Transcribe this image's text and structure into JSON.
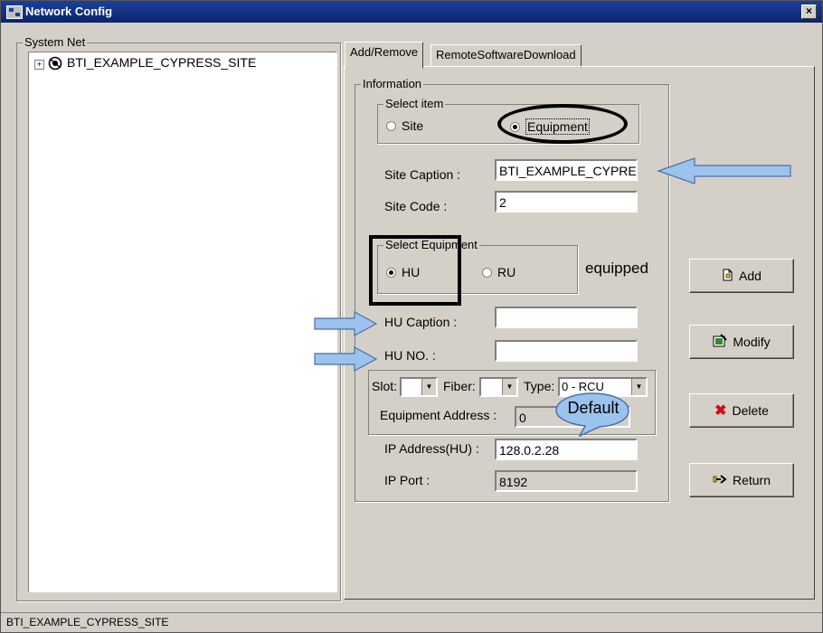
{
  "window": {
    "title": "Network Config"
  },
  "tree": {
    "group_label": "System Net",
    "expander": "+",
    "node_label": "BTI_EXAMPLE_CYPRESS_SITE"
  },
  "tabs": [
    {
      "label": "Add/Remove",
      "active": true
    },
    {
      "label": "RemoteSoftwareDownload",
      "active": false
    }
  ],
  "information": {
    "group_label": "Information",
    "select_item": {
      "group_label": "Select item",
      "options": [
        {
          "label": "Site",
          "selected": false
        },
        {
          "label": "Equipment",
          "selected": true
        }
      ]
    },
    "site_caption": {
      "label": "Site Caption :",
      "value": "BTI_EXAMPLE_CYPRE"
    },
    "site_code": {
      "label": "Site Code :",
      "value": "2"
    },
    "select_equipment": {
      "group_label": "Select Equipment",
      "options": [
        {
          "label": "HU",
          "selected": true
        },
        {
          "label": "RU",
          "selected": false
        }
      ]
    },
    "equipped_text": "equipped",
    "hu_caption": {
      "label": "HU Caption :",
      "value": ""
    },
    "hu_no": {
      "label": "HU NO. :",
      "value": ""
    },
    "slot": {
      "label": "Slot:",
      "value": ""
    },
    "fiber": {
      "label": "Fiber:",
      "value": ""
    },
    "type": {
      "label": "Type:",
      "value": "0 - RCU"
    },
    "equipment_address": {
      "label": "Equipment Address :",
      "value": "0"
    },
    "ip_address": {
      "label": "IP Address(HU) :",
      "value": "128.0.2.28"
    },
    "ip_port": {
      "label": "IP Port :",
      "value": "8192"
    }
  },
  "buttons": {
    "add": "Add",
    "modify": "Modify",
    "delete": "Delete",
    "return": "Return"
  },
  "annotation": {
    "callout_text": "Default",
    "arrow_color": "#9cc3ee"
  },
  "statusbar": {
    "text": "BTI_EXAMPLE_CYPRESS_SITE"
  }
}
